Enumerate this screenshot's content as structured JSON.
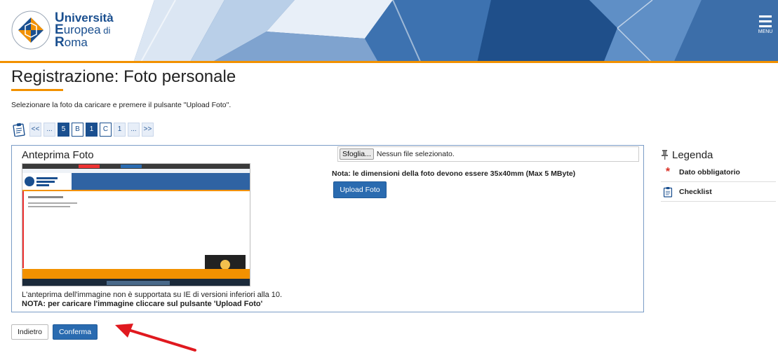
{
  "header": {
    "logo_line1_cap": "U",
    "logo_line1_rest": "niversità",
    "logo_line2_cap": "E",
    "logo_line2_rest": "uropea",
    "logo_line2_suffix": " di",
    "logo_line3_cap": "R",
    "logo_line3_rest": "oma",
    "menu_label": "MENU",
    "seal_text": "ROMA UBI MAIOR"
  },
  "page": {
    "title": "Registrazione: Foto personale",
    "instructions": "Selezionare la foto da caricare e premere il pulsante \"Upload Foto\"."
  },
  "steps": [
    {
      "label": "<<",
      "style": "light"
    },
    {
      "label": "...",
      "style": "light"
    },
    {
      "label": "5",
      "style": "filled"
    },
    {
      "label": "B",
      "style": "outline"
    },
    {
      "label": "1",
      "style": "filled"
    },
    {
      "label": "C",
      "style": "outline"
    },
    {
      "label": "1",
      "style": "light"
    },
    {
      "label": "...",
      "style": "light"
    },
    {
      "label": ">>",
      "style": "light"
    }
  ],
  "preview": {
    "title": "Anteprima Foto",
    "note": "L'anteprima dell'immagine non è supportata su IE di versioni inferiori alla 10.",
    "note_bold": "NOTA: per caricare l'immagine cliccare sul pulsante 'Upload Foto'"
  },
  "upload": {
    "browse_label": "Sfoglia...",
    "file_status": "Nessun file selezionato.",
    "size_note": "Nota: le dimensioni della foto devono essere 35x40mm (Max 5 MByte)",
    "upload_label": "Upload Foto"
  },
  "legend": {
    "title": "Legenda",
    "items": [
      {
        "icon": "asterisk-icon",
        "label": "Dato obbligatorio"
      },
      {
        "icon": "clipboard-icon",
        "label": "Checklist"
      }
    ]
  },
  "footer": {
    "back_label": "Indietro",
    "confirm_label": "Conferma"
  },
  "colors": {
    "brand_blue": "#1a4f8f",
    "accent_orange": "#f29100",
    "button_blue": "#2a6bb0",
    "required_red": "#d93025",
    "arrow_red": "#e0191f"
  }
}
